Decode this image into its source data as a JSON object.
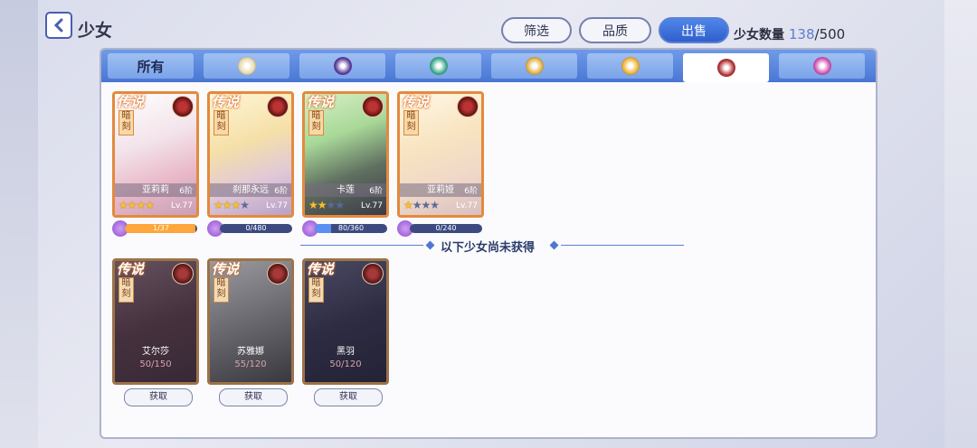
{
  "header": {
    "title": "少女",
    "filter_label": "筛选",
    "quality_label": "品质",
    "sell_label": "出售",
    "count_label": "少女数量",
    "count_current": "138",
    "count_max": "/500"
  },
  "tabs": [
    {
      "label": "所有",
      "icon": "all"
    },
    {
      "icon": "light-element-icon",
      "color": "#e8d9a8"
    },
    {
      "icon": "dark-element-icon",
      "color": "#5a3a9a"
    },
    {
      "icon": "wind-element-icon",
      "color": "#3aaa8a"
    },
    {
      "icon": "earth-element-icon",
      "color": "#e0b040"
    },
    {
      "icon": "sun-element-icon",
      "color": "#f0b030"
    },
    {
      "icon": "fire-element-icon",
      "color": "#b03030",
      "selected": true
    },
    {
      "icon": "candy-element-icon",
      "color": "#d050b0"
    }
  ],
  "obtained": [
    {
      "rarity": "传说",
      "type": "暗刻",
      "name": "亚莉莉",
      "hint": "6阶",
      "stars": 4,
      "level": "Lv.77",
      "bar_text": "1/37",
      "bar_fill": 0.97,
      "bar_color": "orange"
    },
    {
      "rarity": "传说",
      "type": "暗刻",
      "name": "刹那永远",
      "hint": "6阶",
      "stars": 3,
      "level": "Lv.77",
      "bar_text": "0/480",
      "bar_fill": 0.0,
      "bar_color": "blue"
    },
    {
      "rarity": "传说",
      "type": "暗刻",
      "name": "卡莲",
      "hint": "6阶",
      "stars": 2,
      "level": "Lv.77",
      "bar_text": "80/360",
      "bar_fill": 0.22,
      "bar_color": "blue"
    },
    {
      "rarity": "传说",
      "type": "暗刻",
      "name": "亚莉娅",
      "hint": "6阶",
      "stars": 1,
      "level": "Lv.77",
      "bar_text": "0/240",
      "bar_fill": 0.0,
      "bar_color": "blue"
    }
  ],
  "divider_text": "以下少女尚未获得",
  "unobtained": [
    {
      "rarity": "传说",
      "type": "暗刻",
      "name": "艾尔莎",
      "progress": "50/150",
      "button": "获取"
    },
    {
      "rarity": "传说",
      "type": "暗刻",
      "name": "苏雅娜",
      "progress": "55/120",
      "button": "获取"
    },
    {
      "rarity": "传说",
      "type": "暗刻",
      "name": "黑羽",
      "progress": "50/120",
      "button": "获取"
    }
  ]
}
